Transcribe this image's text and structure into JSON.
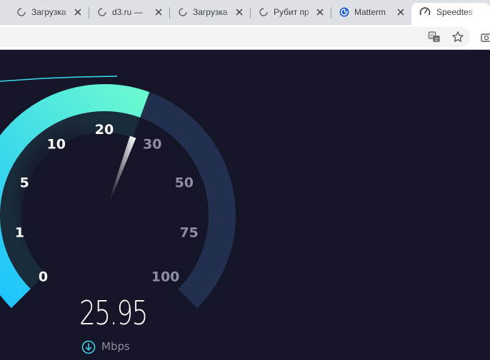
{
  "browser": {
    "tabs": [
      {
        "title": "Загрузка",
        "icon": "loading-spinner-icon",
        "active": false
      },
      {
        "title": "d3.ru — ",
        "icon": "loading-spinner-icon",
        "active": false
      },
      {
        "title": "Загрузка",
        "icon": "loading-spinner-icon",
        "active": false
      },
      {
        "title": "Рубит пр",
        "icon": "loading-spinner-icon",
        "active": false
      },
      {
        "title": "Matterm",
        "icon": "mattermost-icon",
        "active": false
      },
      {
        "title": "Speedtes",
        "icon": "speedometer-icon",
        "active": true
      }
    ],
    "toolbar_icons": [
      "translate-icon",
      "bookmark-star-icon",
      "camera-icon"
    ]
  },
  "speedtest": {
    "gauge": {
      "labels": [
        "0",
        "1",
        "5",
        "10",
        "20",
        "30",
        "50",
        "75",
        "100"
      ],
      "current_value": 25.95,
      "max_value": 100
    },
    "readout": "25.95",
    "unit": "Mbps",
    "unit_icon": "download-arrow-icon",
    "colors": {
      "background": "#141628",
      "arc_track": "#232f4f",
      "arc_fill_start": "#1ac1ff",
      "arc_fill_end": "#6afad0",
      "needle": "#ffffff",
      "label_active": "#ffffff",
      "label_inactive": "#8d8e9f",
      "graph_line": "#3ddcf4"
    }
  }
}
